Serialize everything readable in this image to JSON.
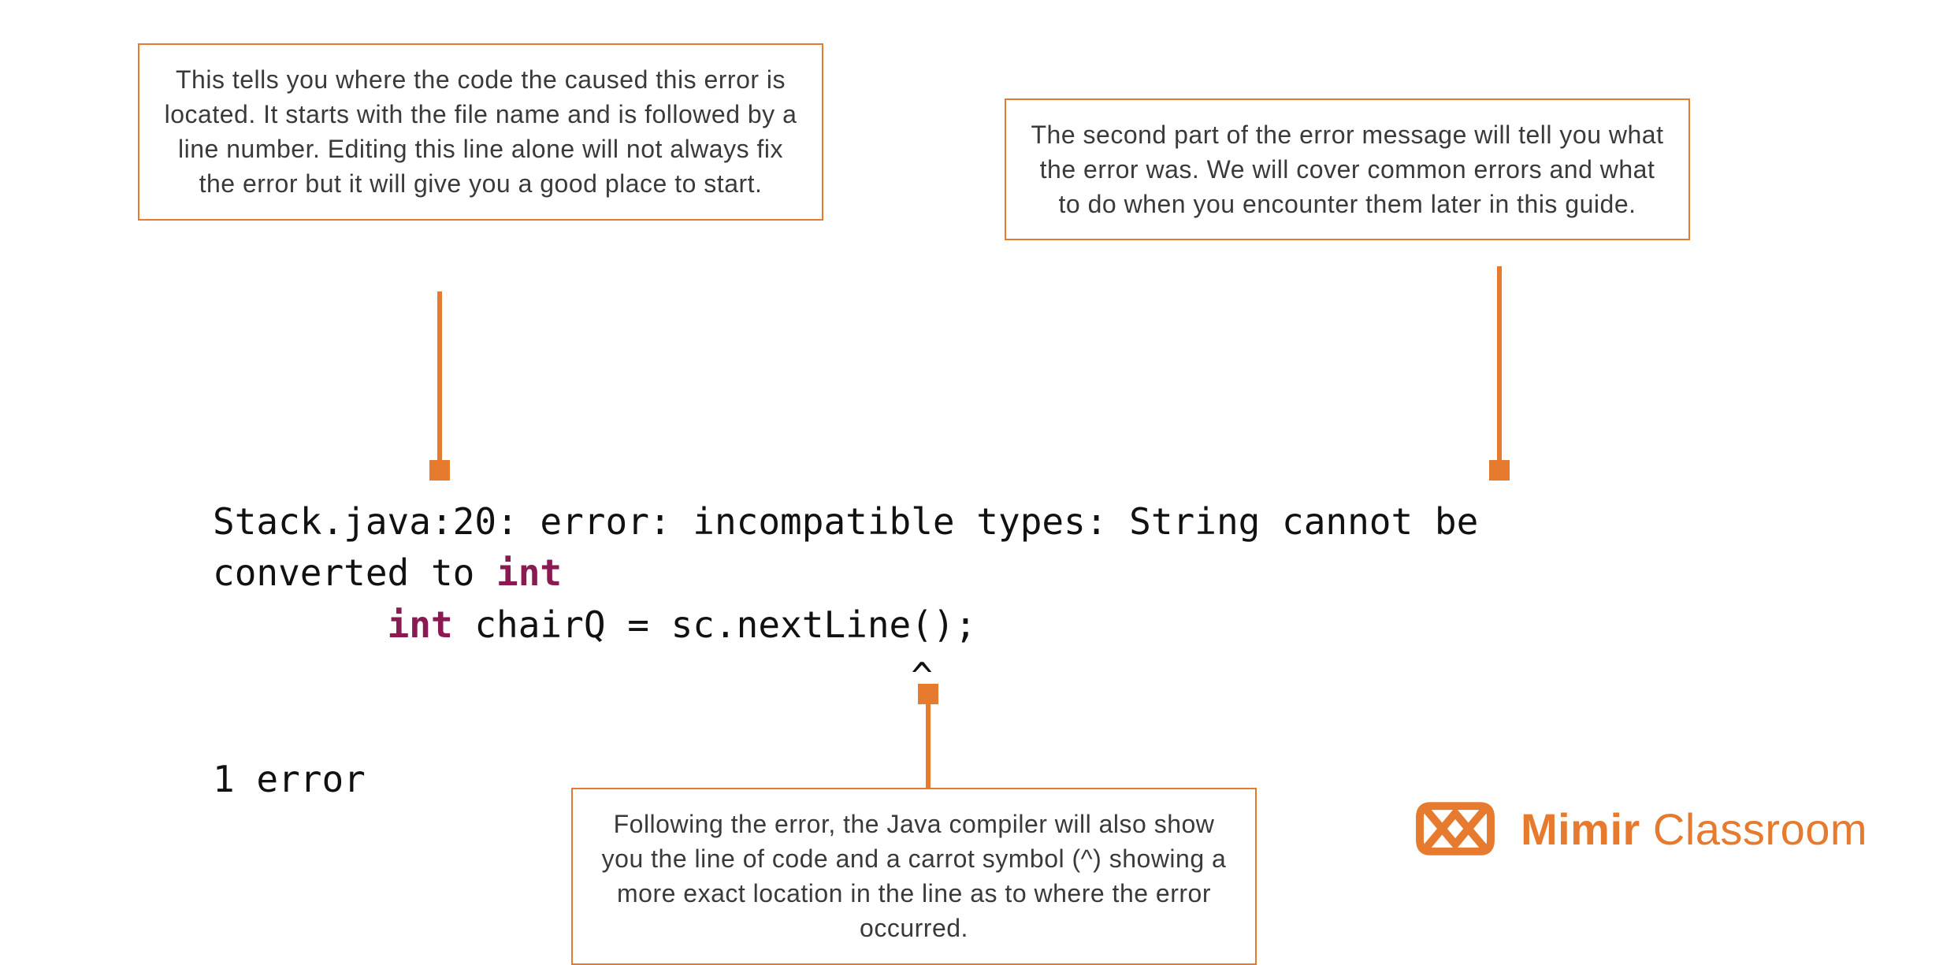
{
  "callouts": {
    "location": "This tells you where the code the caused this error is located. It starts with the file name and is followed by a line number. Editing this line alone will not always fix the error but it will give you a good place to start.",
    "message": "The second part of the error message will tell you what the error was. We will cover common errors and what to do when you encounter them later in this guide.",
    "caret": "Following the error, the Java compiler will also show you the line of code and a carrot symbol (^) showing a more exact location in the line as to where the error occurred."
  },
  "code": {
    "line1_prefix": "Stack.java:20: error: incompatible types: String cannot be\nconverted to ",
    "line1_kw": "int",
    "line2_indent": "        ",
    "line2_kw": "int",
    "line2_rest": " chairQ = sc.nextLine();",
    "caret_line": "                                ^",
    "footer": "1 error"
  },
  "brand": {
    "name_bold": "Mimir",
    "name_light": " Classroom"
  },
  "colors": {
    "accent": "#e67a2e",
    "keyword": "#8a1a52"
  }
}
